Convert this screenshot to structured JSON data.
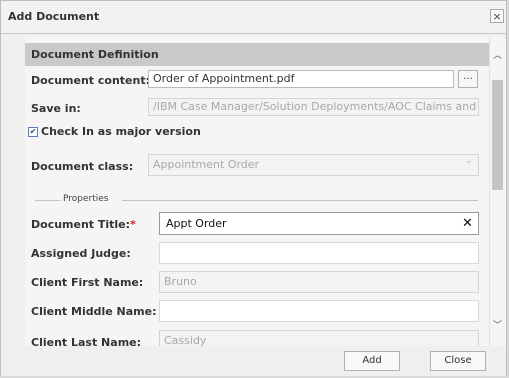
{
  "dialog": {
    "title": "Add Document",
    "close_glyph": "×",
    "icons": {
      "close": "close-icon",
      "clear": "clear-icon",
      "browse": "ellipsis-icon"
    }
  },
  "definition": {
    "section_title": "Document Definition",
    "content_label": "Document content:",
    "content_value": "Order of Appointment.pdf",
    "browse_label": "...",
    "save_in_label": "Save in:",
    "save_in_value": "/IBM Case Manager/Solution Deployments/AOC Claims and Payment",
    "major_version_label": "Check In as major version",
    "major_version_checked": true,
    "class_label": "Document class:",
    "class_value": "Appointment Order"
  },
  "properties": {
    "group_label": "Properties",
    "fields": [
      {
        "label": "Document Title:",
        "required": true,
        "value": "Appt Order"
      },
      {
        "label": "Assigned Judge:",
        "required": false,
        "value": ""
      },
      {
        "label": "Client First Name:",
        "required": false,
        "value": "Bruno"
      },
      {
        "label": "Client Middle Name:",
        "required": false,
        "value": ""
      },
      {
        "label": "Client Last Name:",
        "required": false,
        "value": "Cassidy"
      }
    ]
  },
  "footer": {
    "add_label": "Add",
    "close_label": "Close"
  },
  "required_mark": "*"
}
